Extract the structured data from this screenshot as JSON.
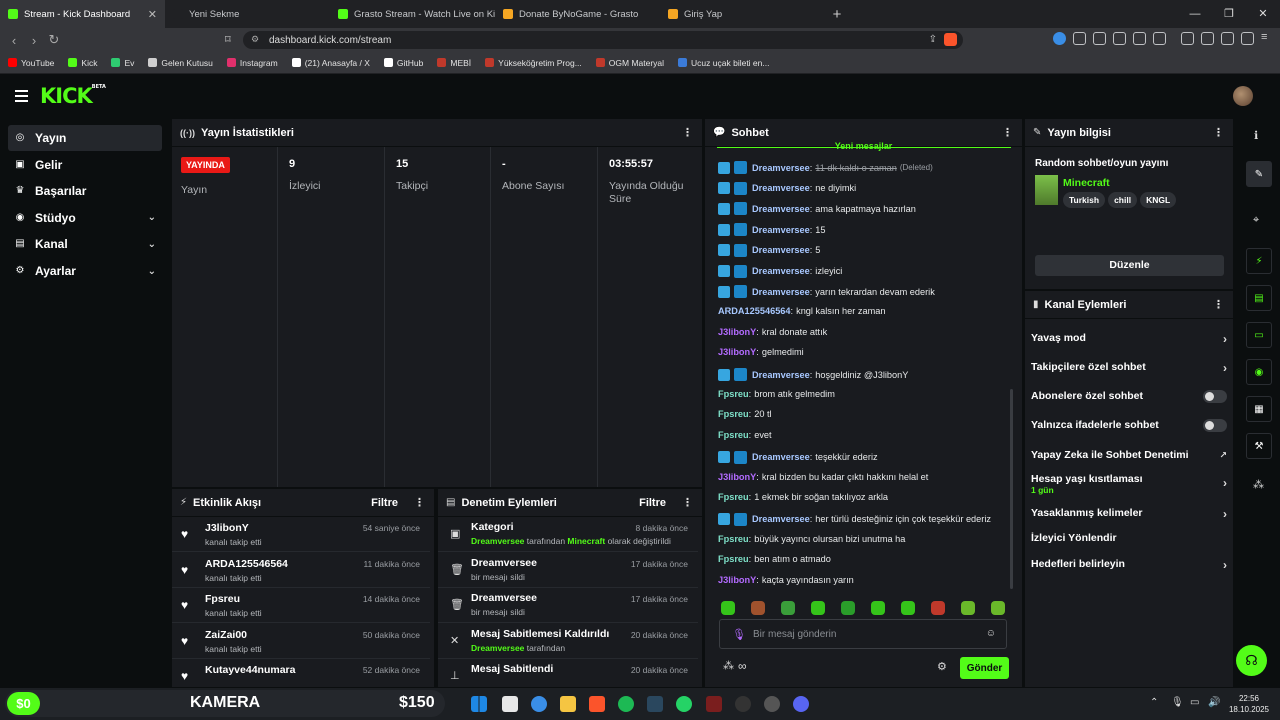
{
  "browser": {
    "tabs": [
      {
        "title": "Stream - Kick Dashboard",
        "color": "#53fc18",
        "active": true
      },
      {
        "title": "Yeni Sekme",
        "color": "#202124",
        "active": false
      },
      {
        "title": "Grasto Stream - Watch Live on Kick",
        "color": "#53fc18",
        "active": false
      },
      {
        "title": "Donate ByNoGame - Grasto",
        "color": "#f5a623",
        "active": false
      },
      {
        "title": "Giriş Yap",
        "color": "#f5a623",
        "active": false
      }
    ],
    "url": "dashboard.kick.com/stream",
    "bookmarks": [
      {
        "label": "YouTube",
        "color": "#ff0000"
      },
      {
        "label": "Kick",
        "color": "#53fc18"
      },
      {
        "label": "Ev",
        "color": "#2ecc71"
      },
      {
        "label": "Gelen Kutusu",
        "color": "#cfcfcf"
      },
      {
        "label": "Instagram",
        "color": "#e1306c"
      },
      {
        "label": "(21) Anasayfa / X",
        "color": "#ffffff"
      },
      {
        "label": "GitHub",
        "color": "#ffffff"
      },
      {
        "label": "MEBİ",
        "color": "#c0392b"
      },
      {
        "label": "Yükseköğretim Prog...",
        "color": "#c0392b"
      },
      {
        "label": "OGM Materyal",
        "color": "#c0392b"
      },
      {
        "label": "Ucuz uçak bileti en...",
        "color": "#3b7bd8"
      }
    ]
  },
  "sidebar": {
    "items": [
      {
        "label": "Yayın",
        "icon": "broadcast-icon",
        "chevron": false
      },
      {
        "label": "Gelir",
        "icon": "income-icon",
        "chevron": false
      },
      {
        "label": "Başarılar",
        "icon": "trophy-icon",
        "chevron": false
      },
      {
        "label": "Stüdyo",
        "icon": "studio-icon",
        "chevron": true
      },
      {
        "label": "Kanal",
        "icon": "channel-icon",
        "chevron": true
      },
      {
        "label": "Ayarlar",
        "icon": "settings-icon",
        "chevron": true
      }
    ]
  },
  "stats": {
    "title": "Yayın İstatistikleri",
    "live_badge": "YAYINDA",
    "cols": [
      {
        "value": "",
        "label": "Yayın"
      },
      {
        "value": "9",
        "label": "İzleyici"
      },
      {
        "value": "15",
        "label": "Takipçi"
      },
      {
        "value": "-",
        "label": "Abone Sayısı"
      },
      {
        "value": "03:55:57",
        "label": "Yayında Olduğu Süre"
      }
    ]
  },
  "activity": {
    "title": "Etkinlik Akışı",
    "filter": "Filtre",
    "items": [
      {
        "name": "J3libonY",
        "sub": "kanalı takip etti",
        "time": "54 saniye önce"
      },
      {
        "name": "ARDA125546564",
        "sub": "kanalı takip etti",
        "time": "11 dakika önce"
      },
      {
        "name": "Fpsreu",
        "sub": "kanalı takip etti",
        "time": "14 dakika önce"
      },
      {
        "name": "ZaiZai00",
        "sub": "kanalı takip etti",
        "time": "50 dakika önce"
      },
      {
        "name": "Kutayve44numara",
        "sub": "",
        "time": "52 dakika önce"
      }
    ]
  },
  "moderation": {
    "title": "Denetim Eylemleri",
    "filter": "Filtre",
    "items": [
      {
        "name": "Kategori",
        "sub_pre": "Dreamversee",
        "sub_mid": " tarafından ",
        "sub_hl": "Minecraft",
        "sub_post": " olarak değiştirildi",
        "time": "8 dakika önce",
        "icon": "category-icon"
      },
      {
        "name": "Dreamversee",
        "sub_pre": "",
        "sub_mid": "bir mesajı sildi",
        "sub_hl": "",
        "sub_post": "",
        "time": "17 dakika önce",
        "icon": "trash-icon"
      },
      {
        "name": "Dreamversee",
        "sub_pre": "",
        "sub_mid": "bir mesajı sildi",
        "sub_hl": "",
        "sub_post": "",
        "time": "17 dakika önce",
        "icon": "trash-icon"
      },
      {
        "name": "Mesaj Sabitlemesi Kaldırıldı",
        "sub_pre": "Dreamversee",
        "sub_mid": " tarafından",
        "sub_hl": "",
        "sub_post": "",
        "time": "20 dakika önce",
        "icon": "unpin-icon"
      },
      {
        "name": "Mesaj Sabitlendi",
        "sub_pre": "",
        "sub_mid": "",
        "sub_hl": "",
        "sub_post": "",
        "time": "20 dakika önce",
        "icon": "pin-icon"
      }
    ]
  },
  "chat": {
    "title": "Sohbet",
    "new_messages": "Yeni mesajlar",
    "messages": [
      {
        "user": "Dreamversee",
        "color": "#a8c8ff",
        "text": "11 dk kaldı o zaman",
        "badges": true,
        "deleted": true,
        "deleted_label": "(Deleted)"
      },
      {
        "user": "Dreamversee",
        "color": "#a8c8ff",
        "text": "ne diyimki",
        "badges": true
      },
      {
        "user": "Dreamversee",
        "color": "#a8c8ff",
        "text": "ama kapatmaya hazırlan",
        "badges": true
      },
      {
        "user": "Dreamversee",
        "color": "#a8c8ff",
        "text": "15",
        "badges": true
      },
      {
        "user": "Dreamversee",
        "color": "#a8c8ff",
        "text": "5",
        "badges": true
      },
      {
        "user": "Dreamversee",
        "color": "#a8c8ff",
        "text": "izleyici",
        "badges": true
      },
      {
        "user": "Dreamversee",
        "color": "#a8c8ff",
        "text": "yarın tekrardan devam ederik",
        "badges": true
      },
      {
        "user": "ARDA125546564",
        "color": "#a8c8ff",
        "text": "kngl kalsın her zaman",
        "badges": false
      },
      {
        "user": "J3libonY",
        "color": "#b36bff",
        "text": "kral donate attık",
        "badges": false
      },
      {
        "user": "J3libonY",
        "color": "#b36bff",
        "text": "gelmedimi",
        "badges": false
      },
      {
        "user": "Dreamversee",
        "color": "#a8c8ff",
        "text": "hoşgeldiniz @J3libonY",
        "badges": true
      },
      {
        "user": "Fpsreu",
        "color": "#7ee0c8",
        "text": "brom atık gelmedim",
        "badges": false
      },
      {
        "user": "Fpsreu",
        "color": "#7ee0c8",
        "text": "20 tl",
        "badges": false
      },
      {
        "user": "Fpsreu",
        "color": "#7ee0c8",
        "text": "evet",
        "badges": false
      },
      {
        "user": "Dreamversee",
        "color": "#a8c8ff",
        "text": "teşekkür ederiz",
        "badges": true
      },
      {
        "user": "J3libonY",
        "color": "#b36bff",
        "text": "kral bizden bu kadar çıktı hakkını helal et",
        "badges": false
      },
      {
        "user": "Fpsreu",
        "color": "#7ee0c8",
        "text": "1 ekmek bir soğan takılıyoz arkla",
        "badges": false
      },
      {
        "user": "Dreamversee",
        "color": "#a8c8ff",
        "text": "her türlü desteğiniz için çok teşekkür ederiz",
        "badges": true
      },
      {
        "user": "Fpsreu",
        "color": "#7ee0c8",
        "text": "büyük yayıncı olursan bizi unutma ha",
        "badges": false
      },
      {
        "user": "Fpsreu",
        "color": "#7ee0c8",
        "text": "ben atım o atmado",
        "badges": false
      },
      {
        "user": "J3libonY",
        "color": "#b36bff",
        "text": "kaçta yayındasın yarın",
        "badges": false
      }
    ],
    "input_placeholder": "Bir mesaj gönderin",
    "send_label": "Gönder"
  },
  "stream_info": {
    "title": "Yayın bilgisi",
    "stream_title": "Random sohbet/oyun yayını",
    "category": "Minecraft",
    "tags": [
      "Turkish",
      "chill",
      "KNGL"
    ],
    "edit_label": "Düzenle"
  },
  "channel_actions": {
    "title": "Kanal Eylemleri",
    "items": [
      {
        "label": "Yavaş mod",
        "type": "arrow",
        "sub": ""
      },
      {
        "label": "Takipçilere özel sohbet",
        "type": "arrow",
        "sub": ""
      },
      {
        "label": "Abonelere özel sohbet",
        "type": "toggle",
        "sub": ""
      },
      {
        "label": "Yalnızca ifadelerle sohbet",
        "type": "toggle",
        "sub": ""
      },
      {
        "label": "Yapay Zeka ile Sohbet Denetimi",
        "type": "external",
        "sub": ""
      },
      {
        "label": "Hesap yaşı kısıtlaması",
        "type": "arrow",
        "sub": "1 gün"
      },
      {
        "label": "Yasaklanmış kelimeler",
        "type": "arrow",
        "sub": ""
      },
      {
        "label": "İzleyici Yönlendir",
        "type": "none",
        "sub": ""
      },
      {
        "label": "Hedefleri belirleyin",
        "type": "arrow",
        "sub": ""
      }
    ]
  },
  "taskbar": {
    "overlay_left": "$0",
    "overlay_title": "KAMERA",
    "overlay_amount": "$150",
    "time": "22:56",
    "date": "18.10.2025"
  }
}
